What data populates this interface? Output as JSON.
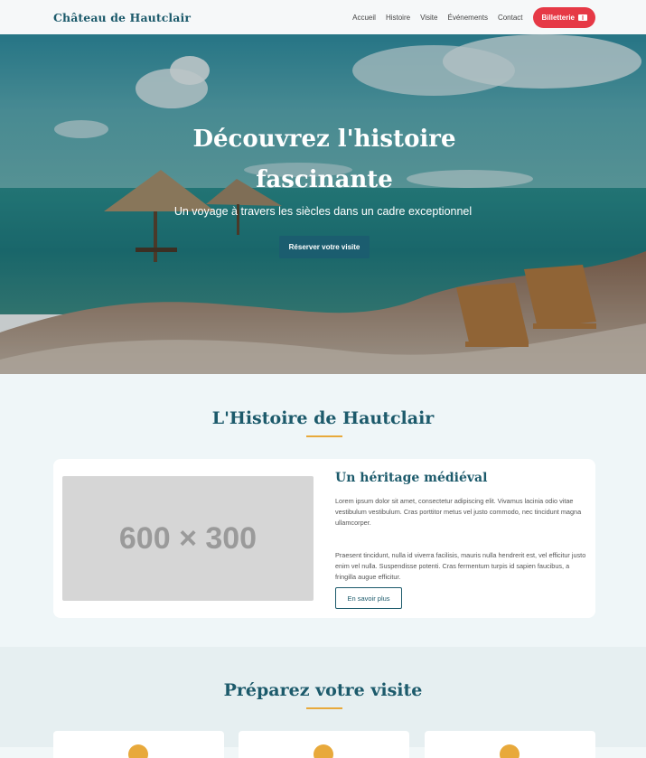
{
  "nav": {
    "brand": "Château de Hautclair",
    "items": [
      "Accueil",
      "Histoire",
      "Visite",
      "Événements",
      "Contact"
    ],
    "ticket_label": "Billetterie"
  },
  "hero": {
    "title": "Découvrez l'histoire fascinante",
    "subtitle": "Un voyage à travers les siècles dans un cadre exceptionnel",
    "cta": "Réserver votre visite"
  },
  "history": {
    "title": "L'Histoire de Hautclair",
    "image_placeholder": "600 × 300",
    "card_title": "Un héritage médiéval",
    "paragraph1": "Lorem ipsum dolor sit amet, consectetur adipiscing elit. Vivamus lacinia odio vitae vestibulum vestibulum. Cras porttitor metus vel justo commodo, nec tincidunt magna ullamcorper.",
    "paragraph2": "Praesent tincidunt, nulla id viverra facilisis, mauris nulla hendrerit est, vel efficitur justo enim vel nulla. Suspendisse potenti. Cras fermentum turpis id sapien faucibus, a fringilla augue efficitur.",
    "more_label": "En savoir plus"
  },
  "visit": {
    "title": "Préparez votre visite"
  },
  "colors": {
    "primary": "#1c5a6b",
    "accent": "#e63946",
    "gold": "#e8a93b"
  }
}
